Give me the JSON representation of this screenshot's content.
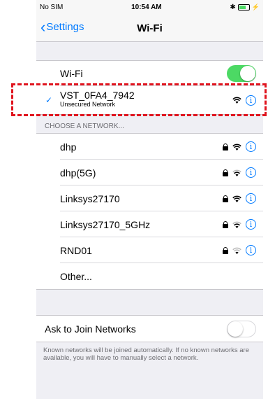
{
  "status_bar": {
    "carrier": "No SIM",
    "time": "10:54 AM"
  },
  "nav": {
    "back_label": "Settings",
    "title": "Wi-Fi"
  },
  "wifi_toggle": {
    "label": "Wi-Fi",
    "on": true
  },
  "connected": {
    "ssid": "VST_0FA4_7942",
    "subtitle": "Unsecured Network"
  },
  "choose_header": "CHOOSE A NETWORK...",
  "networks": [
    {
      "name": "dhp",
      "locked": true
    },
    {
      "name": "dhp(5G)",
      "locked": true
    },
    {
      "name": "Linksys27170",
      "locked": true
    },
    {
      "name": "Linksys27170_5GHz",
      "locked": true
    },
    {
      "name": "RND01",
      "locked": true
    }
  ],
  "other_label": "Other...",
  "ask_join": {
    "label": "Ask to Join Networks",
    "on": false
  },
  "footer": "Known networks will be joined automatically. If no known networks are available, you will have to manually select a network.",
  "colors": {
    "accent": "#007aff",
    "toggle_on": "#4cd964",
    "highlight": "#e0141e"
  }
}
